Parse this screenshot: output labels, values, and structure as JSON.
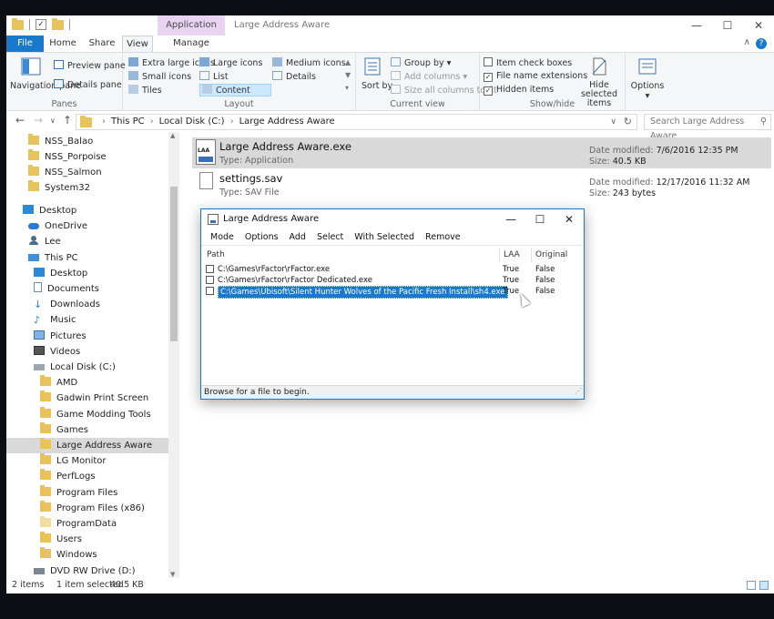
{
  "window": {
    "title": "Large Address Aware",
    "context_tab": "Application Tools",
    "controls": {
      "minimize": "—",
      "maximize": "☐",
      "close": "✕"
    }
  },
  "ribbon_tabs": [
    "File",
    "Home",
    "Share",
    "View",
    "Manage"
  ],
  "ribbon": {
    "panes": {
      "navigation_pane": "Navigation pane",
      "preview_pane": "Preview pane",
      "details_pane": "Details pane",
      "label": "Panes"
    },
    "layout": {
      "items": [
        "Extra large icons",
        "Large icons",
        "Medium icons",
        "Small icons",
        "List",
        "Details",
        "Tiles",
        "Content"
      ],
      "selected": "Content",
      "label": "Layout"
    },
    "current_view": {
      "sort_by": "Sort by",
      "group_by": "Group by",
      "add_columns": "Add columns",
      "size_columns": "Size all columns to fit",
      "label": "Current view"
    },
    "show_hide": {
      "item_check_boxes": "Item check boxes",
      "file_name_extensions": "File name extensions",
      "hidden_items": "Hidden items",
      "hide_selected": "Hide selected items",
      "label": "Show/hide"
    },
    "options": "Options"
  },
  "address": {
    "crumbs": [
      "This PC",
      "Local Disk (C:)",
      "Large Address Aware"
    ],
    "search_placeholder": "Search Large Address Aware"
  },
  "nav": [
    {
      "label": "NSS_Balao",
      "icon": "folder-icon"
    },
    {
      "label": "NSS_Porpoise",
      "icon": "folder-icon"
    },
    {
      "label": "NSS_Salmon",
      "icon": "folder-icon"
    },
    {
      "label": "System32",
      "icon": "folder-icon"
    },
    {
      "label": "Desktop",
      "icon": "desktop-icon"
    },
    {
      "label": "OneDrive",
      "icon": "cloud-icon"
    },
    {
      "label": "Lee",
      "icon": "user-icon"
    },
    {
      "label": "This PC",
      "icon": "computer-icon"
    },
    {
      "label": "Desktop",
      "icon": "desktop-icon"
    },
    {
      "label": "Documents",
      "icon": "document-icon"
    },
    {
      "label": "Downloads",
      "icon": "download-icon"
    },
    {
      "label": "Music",
      "icon": "music-icon"
    },
    {
      "label": "Pictures",
      "icon": "picture-icon"
    },
    {
      "label": "Videos",
      "icon": "video-icon"
    },
    {
      "label": "Local Disk (C:)",
      "icon": "disk-icon"
    },
    {
      "label": "AMD",
      "icon": "folder-icon"
    },
    {
      "label": "Gadwin Print Screen",
      "icon": "folder-icon"
    },
    {
      "label": "Game Modding Tools",
      "icon": "folder-icon"
    },
    {
      "label": "Games",
      "icon": "folder-icon"
    },
    {
      "label": "Large Address Aware",
      "icon": "folder-icon",
      "selected": true
    },
    {
      "label": "LG Monitor",
      "icon": "folder-icon"
    },
    {
      "label": "PerfLogs",
      "icon": "folder-icon"
    },
    {
      "label": "Program Files",
      "icon": "folder-icon"
    },
    {
      "label": "Program Files (x86)",
      "icon": "folder-icon"
    },
    {
      "label": "ProgramData",
      "icon": "folder-icon"
    },
    {
      "label": "Users",
      "icon": "folder-icon"
    },
    {
      "label": "Windows",
      "icon": "folder-icon"
    },
    {
      "label": "DVD RW Drive (D:)",
      "icon": "dvd-icon"
    }
  ],
  "files": [
    {
      "name": "Large Address Aware.exe",
      "type": "Type: Application",
      "modified_label": "Date modified:",
      "modified": "7/6/2016 12:35 PM",
      "size_label": "Size:",
      "size": "40.5 KB",
      "icon_text": "LAA"
    },
    {
      "name": "settings.sav",
      "type": "Type: SAV File",
      "modified_label": "Date modified:",
      "modified": "12/17/2016 11:32 AM",
      "size_label": "Size:",
      "size": "243 bytes"
    }
  ],
  "dialog": {
    "title": "Large Address Aware",
    "menu": [
      "Mode",
      "Options",
      "Add",
      "Select",
      "With Selected",
      "Remove"
    ],
    "columns": [
      "Path",
      "LAA",
      "Original"
    ],
    "rows": [
      {
        "path": "C:\\Games\\rFactor\\rFactor.exe",
        "laa": "True",
        "original": "False"
      },
      {
        "path": "C:\\Games\\rFactor\\rFactor Dedicated.exe",
        "laa": "True",
        "original": "False"
      },
      {
        "path": "C:\\Games\\Ubisoft\\Silent Hunter Wolves of the Pacific Fresh Install\\sh4.exe",
        "laa": "True",
        "original": "False",
        "selected": true
      }
    ],
    "status": "Browse for a file to begin."
  },
  "statusbar": {
    "count": "2 items",
    "selection": "1 item selected",
    "size": "40.5 KB"
  },
  "colors": {
    "accent": "#1979ca",
    "context_tab": "#e8d3f2",
    "selection": "#d9d9d9"
  }
}
